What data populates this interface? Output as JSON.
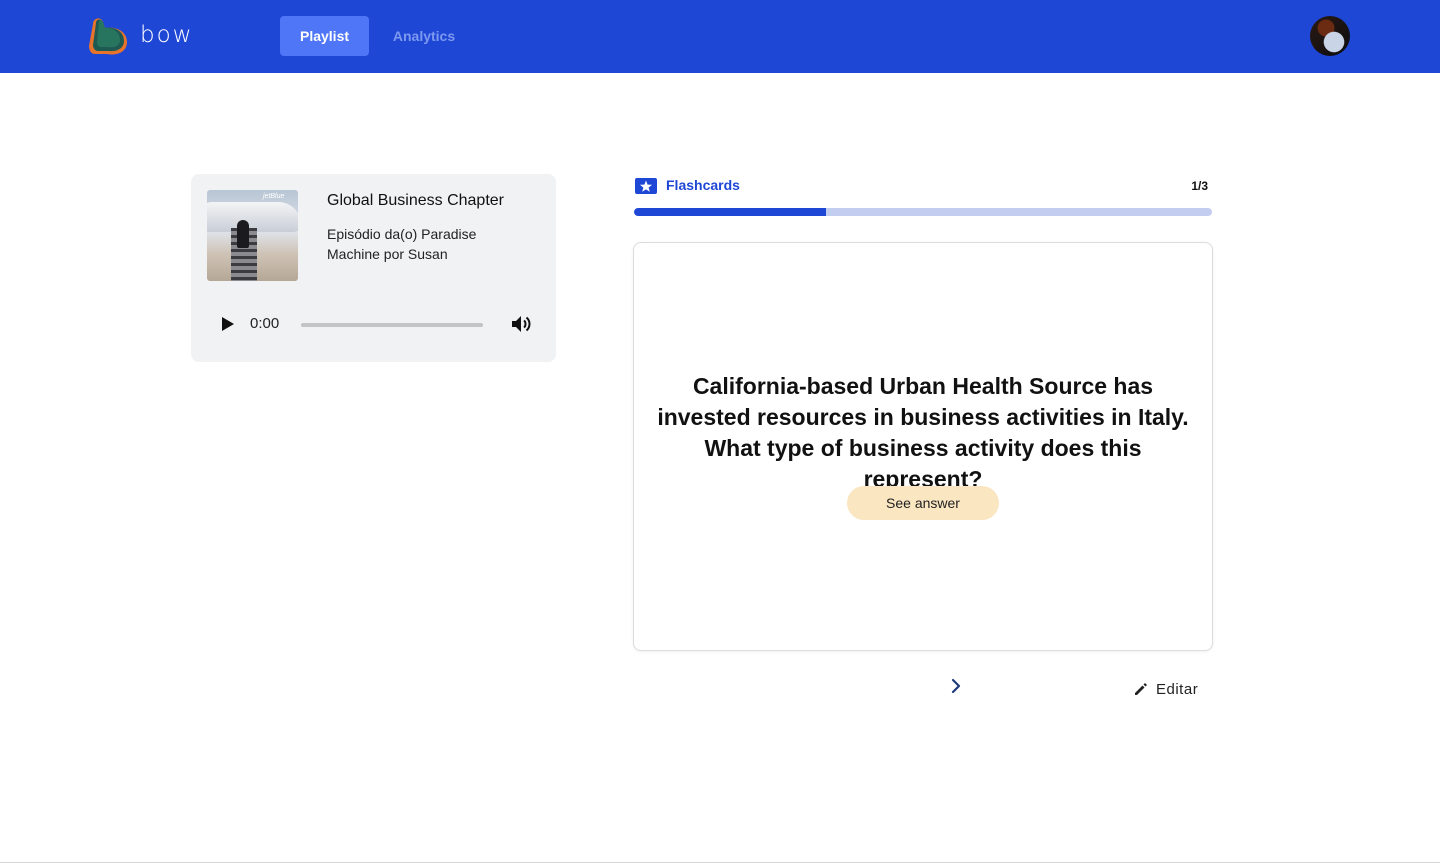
{
  "app": {
    "name": "bow",
    "brand_colors": {
      "header": "#1f47d6",
      "active_tab": "#4f76f6",
      "accent": "#1f47d6",
      "answer_button": "#fbe6c2"
    }
  },
  "nav": {
    "tabs": [
      {
        "label": "Playlist",
        "active": true
      },
      {
        "label": "Analytics",
        "active": false
      }
    ]
  },
  "player": {
    "title": "Global Business Chapter",
    "subtitle": "Episódio da(o) Paradise Machine por Susan",
    "time": "0:00",
    "thumbnail_brand": "jetBlue",
    "icons": {
      "play": "play-icon",
      "volume": "volume-icon"
    }
  },
  "flashcards": {
    "label": "Flashcards",
    "counter": "1/3",
    "current": 1,
    "total": 3,
    "progress_fraction": 0.333,
    "question": "California-based Urban Health Source has invested resources in business activities in Italy. What type of business activity does this represent?",
    "answer_button": "See answer",
    "edit_label": "Editar",
    "icons": {
      "header": "star-card-icon",
      "next": "chevron-right-icon",
      "edit": "pencil-icon"
    }
  }
}
